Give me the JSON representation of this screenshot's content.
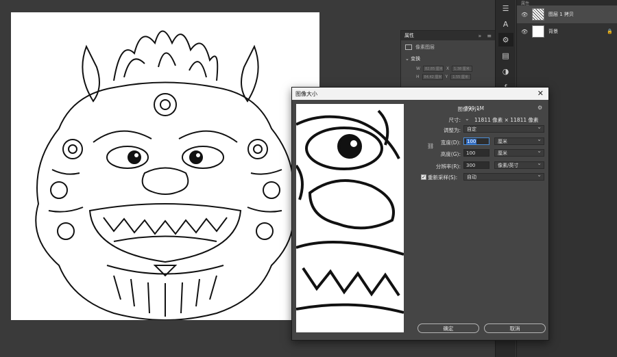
{
  "layers_panel": {
    "top_label": "属性",
    "layers": [
      {
        "name": "图层 1 拷贝",
        "selected": true
      },
      {
        "name": "背景",
        "locked": true
      }
    ]
  },
  "tool_strip": {
    "icons": [
      "sliders-icon",
      "type-icon",
      "properties-icon",
      "document-icon",
      "adjust-icon",
      "fx-icon"
    ]
  },
  "properties_panel": {
    "title": "属性",
    "collapse": "»",
    "menu": "≡",
    "subtitle": "像素图层",
    "section": "变换",
    "w_label": "W",
    "w_value": "82.85 厘米",
    "x_label": "X",
    "x_value": "1.38 厘米",
    "h_label": "H",
    "h_value": "84.42 厘米",
    "y_label": "Y",
    "y_value": "1.55 厘米"
  },
  "dialog": {
    "title": "图像大小",
    "image_size_label": "图像大小:",
    "image_size_value": "399.1M",
    "dimensions_label": "尺寸:",
    "dimensions_value": "11811 像素  ×  11811 像素",
    "fit_label": "调整为:",
    "fit_value": "自定",
    "width_label": "宽度(D):",
    "width_value": "100",
    "width_unit": "厘米",
    "height_label": "高度(G):",
    "height_value": "100",
    "height_unit": "厘米",
    "resolution_label": "分辨率(R):",
    "resolution_value": "300",
    "resolution_unit": "像素/英寸",
    "resample_label": "重新采样(S):",
    "resample_checked": true,
    "resample_value": "自动",
    "ok_label": "确定",
    "cancel_label": "取消"
  }
}
